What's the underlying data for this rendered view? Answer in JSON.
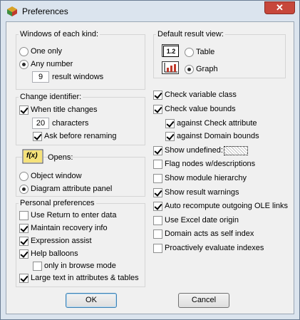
{
  "window": {
    "title": "Preferences",
    "close_glyph": "✕"
  },
  "windows_group": {
    "label": "Windows of each kind:",
    "one_only": "One only",
    "any_number": "Any number",
    "selected": "any_number",
    "count_value": "9",
    "count_suffix": "result windows"
  },
  "change_identifier": {
    "label": "Change identifier:",
    "when_title_changes": "When title changes",
    "when_title_changes_checked": true,
    "chars_value": "20",
    "chars_suffix": "characters",
    "ask_before_renaming": "Ask before renaming",
    "ask_before_renaming_checked": true
  },
  "opens_group": {
    "icon_text": "f(x)",
    "label": "Opens:",
    "object_window": "Object window",
    "diagram_panel": "Diagram attribute panel",
    "selected": "diagram_panel"
  },
  "personal": {
    "label": "Personal preferences",
    "items": [
      {
        "label": "Use Return to enter data",
        "checked": false
      },
      {
        "label": "Maintain recovery info",
        "checked": true
      },
      {
        "label": "Expression assist",
        "checked": true
      },
      {
        "label": "Help balloons",
        "checked": true
      },
      {
        "label": "only in browse mode",
        "checked": false
      },
      {
        "label": "Large text in attributes & tables",
        "checked": true
      }
    ]
  },
  "default_view": {
    "label": "Default result view:",
    "table_icon_text": "1.2",
    "table": "Table",
    "graph": "Graph",
    "selected": "graph"
  },
  "checks": {
    "items": [
      {
        "label": "Check variable class",
        "checked": true
      },
      {
        "label": "Check value bounds",
        "checked": true
      },
      {
        "label": "against Check attribute",
        "checked": true
      },
      {
        "label": "against Domain bounds",
        "checked": true
      },
      {
        "label": "Show undefined:",
        "checked": true
      },
      {
        "label": "Flag nodes w/descriptions",
        "checked": false
      },
      {
        "label": "Show module hierarchy",
        "checked": false
      },
      {
        "label": "Show result warnings",
        "checked": true
      },
      {
        "label": "Auto recompute outgoing OLE links",
        "checked": true
      },
      {
        "label": "Use Excel date origin",
        "checked": false
      },
      {
        "label": "Domain acts as self index",
        "checked": false
      },
      {
        "label": "Proactively evaluate indexes",
        "checked": false
      }
    ]
  },
  "buttons": {
    "ok": "OK",
    "cancel": "Cancel"
  }
}
